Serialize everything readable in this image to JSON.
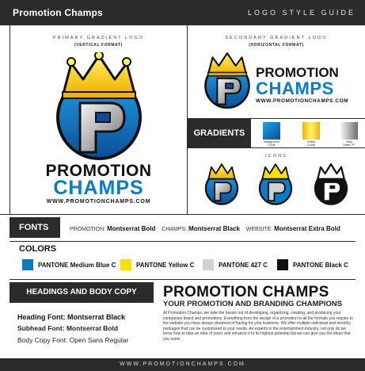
{
  "header": {
    "brand": "Promotion Champs",
    "guide_title": "LOGO STYLE GUIDE"
  },
  "primary_logo": {
    "caption": "PRIMARY GRADIENT LOGO",
    "format": "(VERTICAL FORMAT)",
    "word_top": "PROMOTION",
    "word_bottom": "CHAMPS",
    "url": "WWW.PROMOTIONCHAMPS.COM"
  },
  "secondary_logo": {
    "caption": "SECONDARY GRADIENT LOGO",
    "format": "(HORIZONTAL FORMAT)",
    "word_top": "PROMOTION",
    "word_bottom": "CHAMPS",
    "url": "WWW.PROMOTIONCHAMPS.COM"
  },
  "gradients": {
    "title": "GRADIENTS",
    "items": [
      {
        "label_1": "Background",
        "label_2": "Circle",
        "from": "#0b4d9a",
        "to": "#1ea3e6"
      },
      {
        "label_1": "Yellow",
        "label_2": "Crown",
        "from": "#f0b400",
        "to": "#fff36a"
      },
      {
        "label_1": "Grey",
        "label_2": "Letter \"P\"",
        "from": "#6e6e6e",
        "to": "#f5f5f5"
      }
    ]
  },
  "icons": {
    "title": "ICONS"
  },
  "fonts": {
    "title": "FONTS",
    "promotion_label": "PROMOTION:",
    "promotion_font": "Montserrat Bold",
    "champs_label": "CHAMPS:",
    "champs_font": "Montserrat Black",
    "website_label": "WEBSITE:",
    "website_font": "Montserrat Extra Bold"
  },
  "colors": {
    "title": "COLORS",
    "items": [
      {
        "name": "PANTONE Medium Blue C",
        "hex": "#0a7bc4"
      },
      {
        "name": "PANTONE Yellow C",
        "hex": "#f7e000"
      },
      {
        "name": "PANTONE 427 C",
        "hex": "#cfd2d4"
      },
      {
        "name": "PANTONE Black C",
        "hex": "#111111"
      }
    ]
  },
  "headings": {
    "title": "HEADINGS AND BODY COPY",
    "heading_font": "Heading Font: Montserrat Black",
    "subhead_font": "Subhead Font: Montserrat Bold",
    "body_font": "Body Copy Font: Open Sans Regular"
  },
  "sample": {
    "heading": "PROMOTION CHAMPS",
    "subhead": "YOUR PROMOTION AND BRANDING CHAMPIONS",
    "body": "At Promotion Champs, we take the hassle out of developing, organizing, creating, and producing your companies brand and promotions. Everything from the design of a promotion in all the formats you require to the website you have always dreamed of having for your business. We offer multiple individual and monthly packages that can be customized to your needs. As experts in the entertainment industry, not only do we know how to take an idea of yours and enhance it to its highest potential but we can give you the ideas that you need."
  },
  "footer": {
    "url": "WWW.PROMOTIONCHAMPS.COM"
  },
  "palette": {
    "dark_bar": "#2b2b2b",
    "brand_blue": "#0a7bc4",
    "crown_yellow": "#f5c400"
  }
}
